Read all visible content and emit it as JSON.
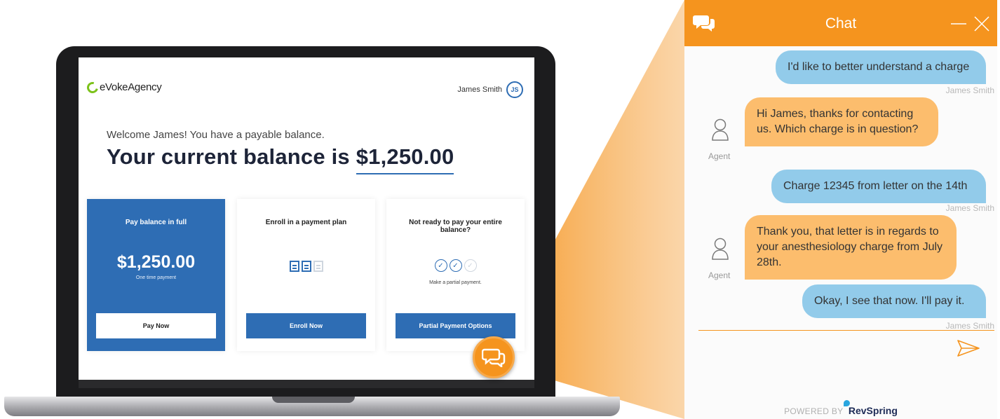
{
  "app": {
    "brand": "eVokeAgency",
    "user_name": "James Smith",
    "user_initials": "JS"
  },
  "hero": {
    "welcome": "Welcome James! You have a payable balance.",
    "balance_prefix": "Your current balance is",
    "balance_amount": "$1,250.00"
  },
  "cards": {
    "pay_full": {
      "title": "Pay balance in full",
      "amount": "$1,250.00",
      "subtitle": "One time payment",
      "button": "Pay Now"
    },
    "payment_plan": {
      "title": "Enroll in a payment plan",
      "button": "Enroll Now"
    },
    "partial": {
      "title": "Not ready to pay your entire balance?",
      "subtitle": "Make a partial payment.",
      "button": "Partial Payment Options"
    }
  },
  "chat": {
    "title": "Chat",
    "messages": [
      {
        "from": "user",
        "text": "I'd like to better understand a charge",
        "sender": "James Smith"
      },
      {
        "from": "agent",
        "text": "Hi James, thanks for contacting us. Which charge is in question?",
        "sender": "Agent"
      },
      {
        "from": "user",
        "text": "Charge 12345 from letter on the 14th",
        "sender": "James Smith"
      },
      {
        "from": "agent",
        "text": "Thank you, that letter is in regards to your anesthesiology charge from July 28th.",
        "sender": "Agent"
      },
      {
        "from": "user",
        "text": "Okay, I see that now. I'll pay it.",
        "sender": "James Smith"
      }
    ],
    "powered_by": "POWERED BY",
    "provider": "RevSpring"
  },
  "colors": {
    "accent_orange": "#f5941e",
    "brand_blue": "#2e6db4",
    "user_bubble": "#92cbea",
    "agent_bubble": "#fcbd6d",
    "brand_green": "#7cc21a"
  },
  "icons": {
    "chat_header": "chat-bubbles-icon",
    "minimize": "minimize-icon",
    "close": "close-icon",
    "agent": "agent-avatar-icon",
    "send": "send-icon"
  }
}
